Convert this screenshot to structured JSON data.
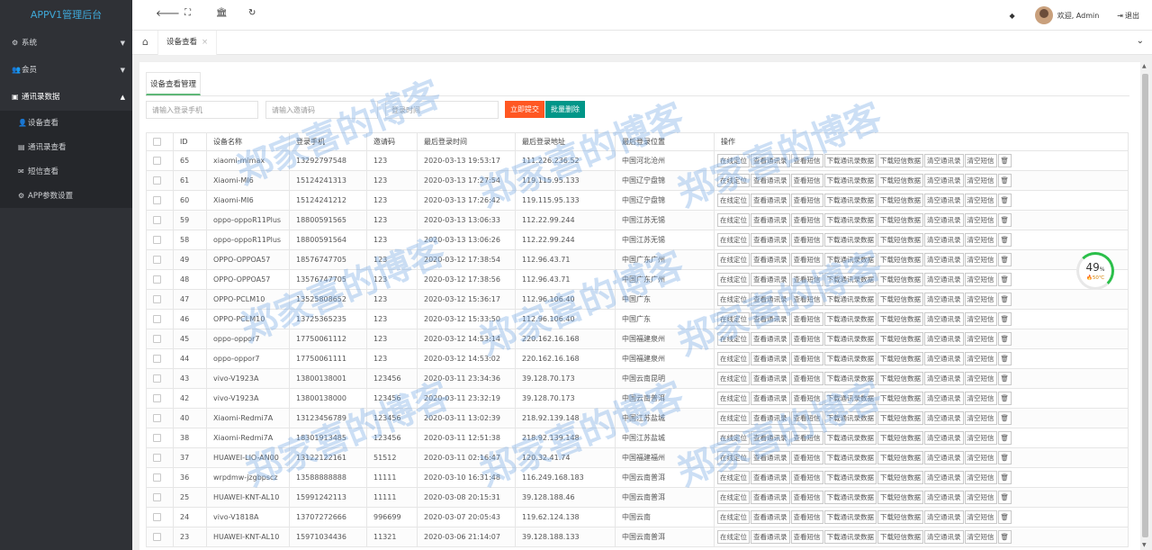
{
  "brand": "APPV1管理后台",
  "sidebar": {
    "menus": [
      {
        "label": "系统",
        "icon": "gear-icon"
      },
      {
        "label": "会员",
        "icon": "users-icon"
      },
      {
        "label": "通讯录数据",
        "icon": "card-icon"
      }
    ],
    "subitems": [
      {
        "label": "设备查看",
        "icon": "user-icon"
      },
      {
        "label": "通讯录查看",
        "icon": "book-icon"
      },
      {
        "label": "短信查看",
        "icon": "envelope-icon"
      },
      {
        "label": "APP参数设置",
        "icon": "gear-icon"
      }
    ]
  },
  "topbar": {
    "welcome": "欢迎, Admin",
    "logout": "退出"
  },
  "tabs": {
    "active": "设备查看"
  },
  "page": {
    "title": "设备查看管理"
  },
  "filters": {
    "phone_placeholder": "请输入登录手机",
    "invite_placeholder": "请输入邀请码",
    "time_placeholder": "登录时间",
    "submit_label": "立即提交",
    "batch_delete_label": "批量删除"
  },
  "table": {
    "headers": [
      "",
      "ID",
      "设备名称",
      "登录手机",
      "邀请码",
      "最后登录时间",
      "最后登录地址",
      "最后登录位置",
      "操作"
    ],
    "actions": [
      "在线定位",
      "查看通讯录",
      "查看短信",
      "下载通讯录数据",
      "下载短信数据",
      "清空通讯录",
      "清空短信",
      "🗑"
    ],
    "rows": [
      {
        "id": "65",
        "device": "xiaomi-mimax",
        "phone": "13292797548",
        "invite": "123",
        "time": "2020-03-13 19:53:17",
        "ip": "111.226.236.52",
        "location": "中国河北沧州"
      },
      {
        "id": "61",
        "device": "Xiaomi-MI6",
        "phone": "15124241313",
        "invite": "123",
        "time": "2020-03-13 17:27:54",
        "ip": "119.115.95.133",
        "location": "中国辽宁盘锦"
      },
      {
        "id": "60",
        "device": "Xiaomi-MI6",
        "phone": "15124241212",
        "invite": "123",
        "time": "2020-03-13 17:26:42",
        "ip": "119.115.95.133",
        "location": "中国辽宁盘锦"
      },
      {
        "id": "59",
        "device": "oppo-oppoR11Plus",
        "phone": "18800591565",
        "invite": "123",
        "time": "2020-03-13 13:06:33",
        "ip": "112.22.99.244",
        "location": "中国江苏无锡"
      },
      {
        "id": "58",
        "device": "oppo-oppoR11Plus",
        "phone": "18800591564",
        "invite": "123",
        "time": "2020-03-13 13:06:26",
        "ip": "112.22.99.244",
        "location": "中国江苏无锡"
      },
      {
        "id": "49",
        "device": "OPPO-OPPOA57",
        "phone": "18576747705",
        "invite": "123",
        "time": "2020-03-12 17:38:54",
        "ip": "112.96.43.71",
        "location": "中国广东广州"
      },
      {
        "id": "48",
        "device": "OPPO-OPPOA57",
        "phone": "13576747705",
        "invite": "123",
        "time": "2020-03-12 17:38:56",
        "ip": "112.96.43.71",
        "location": "中国广东广州"
      },
      {
        "id": "47",
        "device": "OPPO-PCLM10",
        "phone": "13525808652",
        "invite": "123",
        "time": "2020-03-12 15:36:17",
        "ip": "112.96.106.40",
        "location": "中国广东"
      },
      {
        "id": "46",
        "device": "OPPO-PCLM10",
        "phone": "13725365235",
        "invite": "123",
        "time": "2020-03-12 15:33:50",
        "ip": "112.96.106.40",
        "location": "中国广东"
      },
      {
        "id": "45",
        "device": "oppo-oppor7",
        "phone": "17750061112",
        "invite": "123",
        "time": "2020-03-12 14:53:14",
        "ip": "220.162.16.168",
        "location": "中国福建泉州"
      },
      {
        "id": "44",
        "device": "oppo-oppor7",
        "phone": "17750061111",
        "invite": "123",
        "time": "2020-03-12 14:53:02",
        "ip": "220.162.16.168",
        "location": "中国福建泉州"
      },
      {
        "id": "43",
        "device": "vivo-V1923A",
        "phone": "13800138001",
        "invite": "123456",
        "time": "2020-03-11 23:34:36",
        "ip": "39.128.70.173",
        "location": "中国云南昆明"
      },
      {
        "id": "42",
        "device": "vivo-V1923A",
        "phone": "13800138000",
        "invite": "123456",
        "time": "2020-03-11 23:32:19",
        "ip": "39.128.70.173",
        "location": "中国云南普洱"
      },
      {
        "id": "40",
        "device": "Xiaomi-Redmi7A",
        "phone": "13123456789",
        "invite": "123456",
        "time": "2020-03-11 13:02:39",
        "ip": "218.92.139.148",
        "location": "中国江苏盐城"
      },
      {
        "id": "38",
        "device": "Xiaomi-Redmi7A",
        "phone": "18301913485",
        "invite": "123456",
        "time": "2020-03-11 12:51:38",
        "ip": "218.92.139.148",
        "location": "中国江苏盐城"
      },
      {
        "id": "37",
        "device": "HUAWEI-LIO-AN00",
        "phone": "13122122161",
        "invite": "51512",
        "time": "2020-03-11 02:16:47",
        "ip": "120.32.41.74",
        "location": "中国福建福州"
      },
      {
        "id": "36",
        "device": "wrpdmw-jzgbpscz",
        "phone": "13588888888",
        "invite": "11111",
        "time": "2020-03-10 16:31:48",
        "ip": "116.249.168.183",
        "location": "中国云南普洱"
      },
      {
        "id": "25",
        "device": "HUAWEI-KNT-AL10",
        "phone": "15991242113",
        "invite": "11111",
        "time": "2020-03-08 20:15:31",
        "ip": "39.128.188.46",
        "location": "中国云南普洱"
      },
      {
        "id": "24",
        "device": "vivo-V1818A",
        "phone": "13707272666",
        "invite": "996699",
        "time": "2020-03-07 20:05:43",
        "ip": "119.62.124.138",
        "location": "中国云南"
      },
      {
        "id": "23",
        "device": "HUAWEI-KNT-AL10",
        "phone": "15971034436",
        "invite": "11321",
        "time": "2020-03-06 21:14:07",
        "ip": "39.128.188.133",
        "location": "中国云南普洱"
      }
    ]
  },
  "monitor": {
    "percent": "49",
    "percent_unit": "%",
    "temp": "50℃",
    "level": 0.49
  },
  "watermark": "郑家喜的博客",
  "colors": {
    "sidebar_bg": "#2f3136",
    "brand": "#3fa9d9",
    "submit_btn": "#ff5722",
    "batch_btn": "#009688",
    "active_tab_border": "#5fb878"
  }
}
